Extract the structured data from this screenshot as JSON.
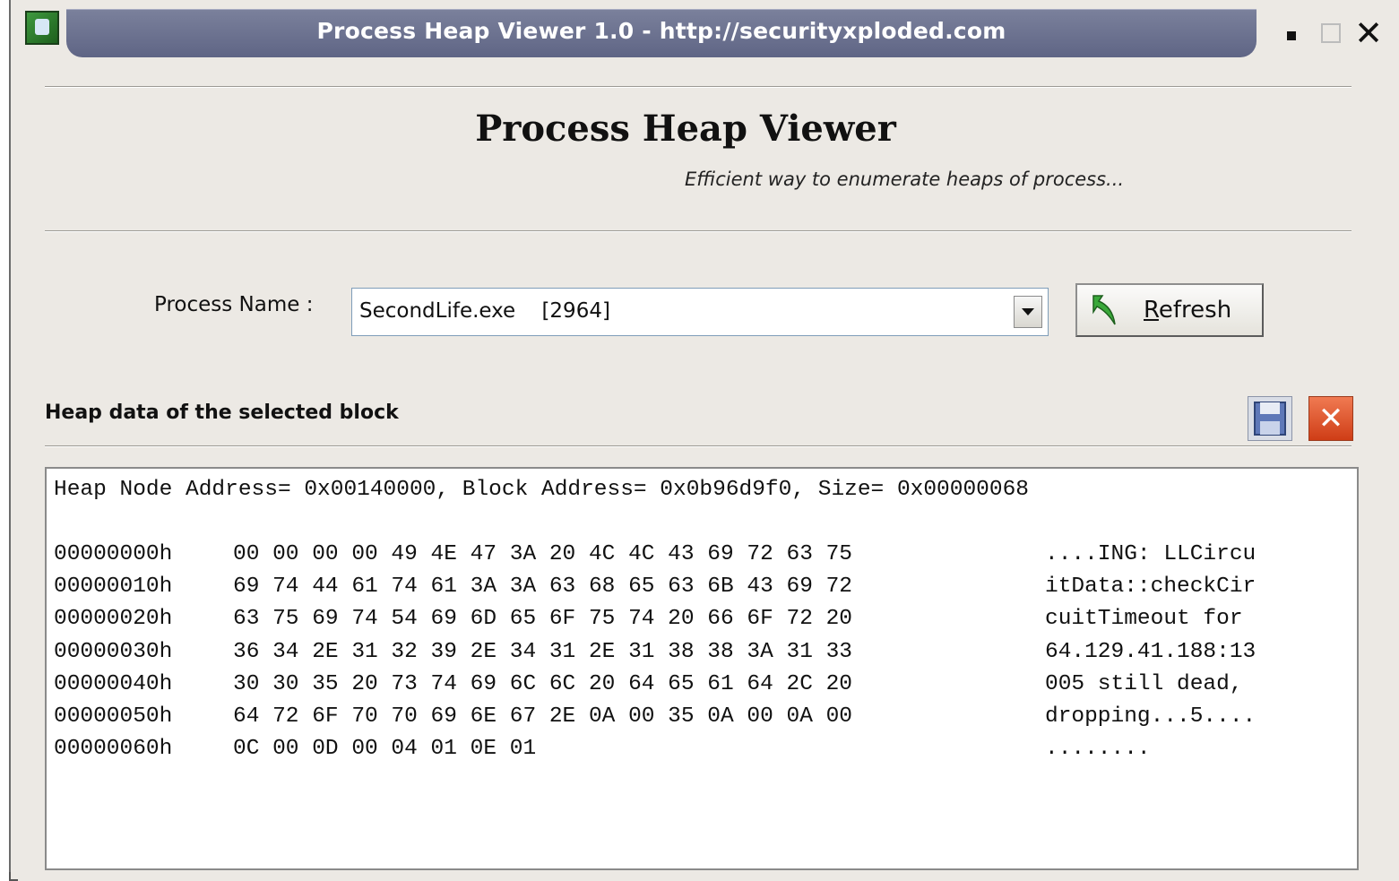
{
  "window": {
    "title": "Process Heap Viewer 1.0 - http://securityxploded.com",
    "icons": {
      "app": "app-logo-icon",
      "minimize": "minimize-icon",
      "maximize": "maximize-icon",
      "close": "close-icon"
    }
  },
  "header": {
    "heading": "Process Heap Viewer",
    "subtitle": "Efficient way to enumerate heaps of process..."
  },
  "process_select": {
    "label": "Process Name :",
    "value": "SecondLife.exe    [2964]",
    "dropdown_icon": "chevron-down-icon"
  },
  "refresh_button": {
    "label_first": "R",
    "label_rest": "efresh",
    "icon": "refresh-arrow-icon"
  },
  "heap_section": {
    "title": "Heap data of the selected block",
    "save_icon": "save-disk-icon",
    "clear_icon": "clear-x-icon"
  },
  "heap_data": {
    "header": "Heap Node Address= 0x00140000, Block Address= 0x0b96d9f0, Size= 0x00000068",
    "lines": [
      {
        "offset": "00000000h",
        "bytes": "00 00 00 00 49 4E 47 3A 20 4C 4C 43 69 72 63 75",
        "ascii": "....ING: LLCircu"
      },
      {
        "offset": "00000010h",
        "bytes": "69 74 44 61 74 61 3A 3A 63 68 65 63 6B 43 69 72",
        "ascii": "itData::checkCir"
      },
      {
        "offset": "00000020h",
        "bytes": "63 75 69 74 54 69 6D 65 6F 75 74 20 66 6F 72 20",
        "ascii": "cuitTimeout for "
      },
      {
        "offset": "00000030h",
        "bytes": "36 34 2E 31 32 39 2E 34 31 2E 31 38 38 3A 31 33",
        "ascii": "64.129.41.188:13"
      },
      {
        "offset": "00000040h",
        "bytes": "30 30 35 20 73 74 69 6C 6C 20 64 65 61 64 2C 20",
        "ascii": "005 still dead, "
      },
      {
        "offset": "00000050h",
        "bytes": "64 72 6F 70 70 69 6E 67 2E 0A 00 35 0A 00 0A 00",
        "ascii": "dropping...5...."
      },
      {
        "offset": "00000060h",
        "bytes": "0C 00 0D 00 04 01 0E 01",
        "ascii": "........"
      }
    ]
  },
  "colors": {
    "window_bg": "#ece9e4",
    "titlebar": "#6b7190",
    "title_text": "#ffffff",
    "clear_button": "#e35a2e"
  }
}
